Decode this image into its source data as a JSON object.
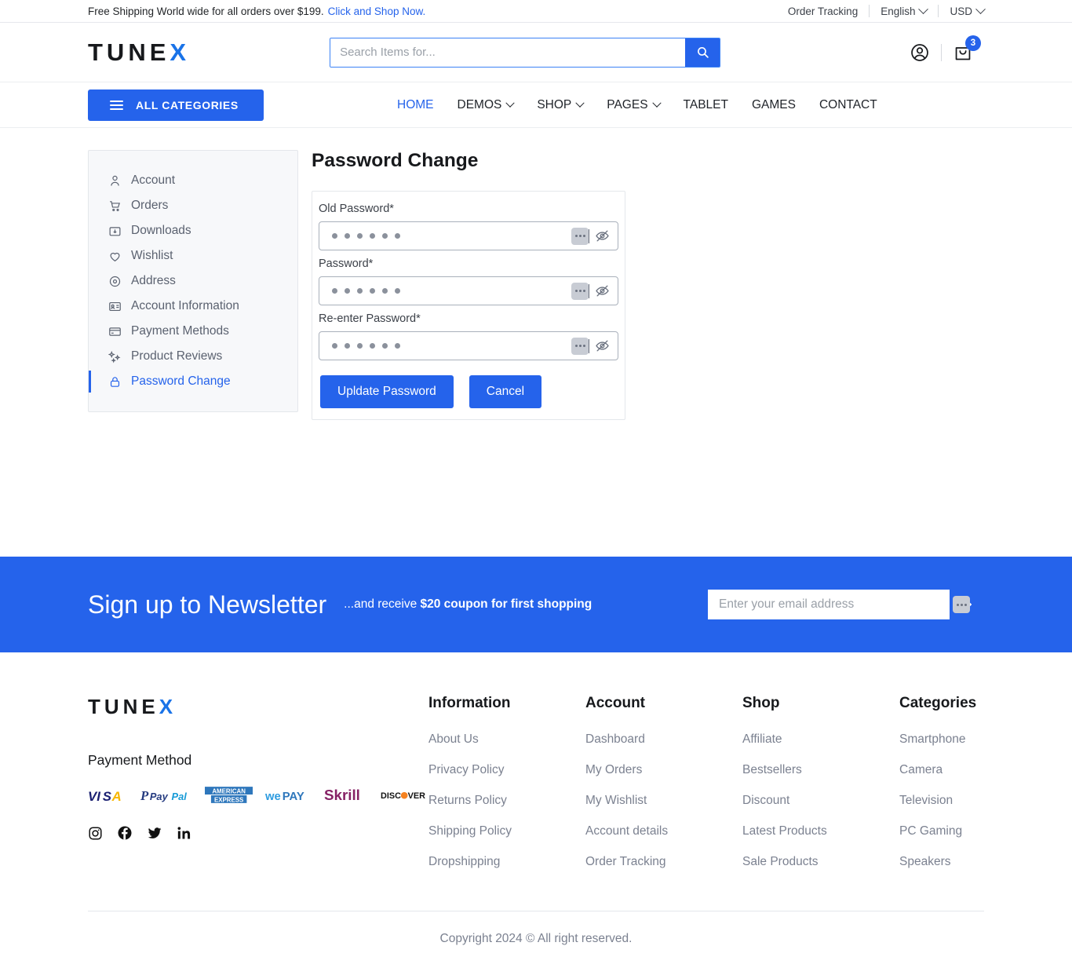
{
  "topbar": {
    "promo_text": "Free Shipping World wide for all orders over $199.",
    "promo_link": "Click and Shop Now.",
    "order_tracking": "Order Tracking",
    "language": "English",
    "currency": "USD"
  },
  "header": {
    "logo_main": "TUNE",
    "logo_accent": "X",
    "search_placeholder": "Search Items for...",
    "search_value": "",
    "cart_count": "3"
  },
  "nav": {
    "all_categories": "ALL CATEGORIES",
    "items": [
      {
        "label": "HOME",
        "active": true,
        "caret": false
      },
      {
        "label": "DEMOS",
        "active": false,
        "caret": true
      },
      {
        "label": "SHOP",
        "active": false,
        "caret": true
      },
      {
        "label": "PAGES",
        "active": false,
        "caret": true
      },
      {
        "label": "TABLET",
        "active": false,
        "caret": false
      },
      {
        "label": "GAMES",
        "active": false,
        "caret": false
      },
      {
        "label": "CONTACT",
        "active": false,
        "caret": false
      }
    ]
  },
  "sidebar": {
    "items": [
      {
        "label": "Account",
        "icon": "user-icon",
        "active": false
      },
      {
        "label": "Orders",
        "icon": "cart-icon",
        "active": false
      },
      {
        "label": "Downloads",
        "icon": "download-box-icon",
        "active": false
      },
      {
        "label": "Wishlist",
        "icon": "heart-icon",
        "active": false
      },
      {
        "label": "Address",
        "icon": "location-pin-icon",
        "active": false
      },
      {
        "label": "Account Information",
        "icon": "id-card-icon",
        "active": false
      },
      {
        "label": "Payment Methods",
        "icon": "credit-card-icon",
        "active": false
      },
      {
        "label": "Product Reviews",
        "icon": "sparkles-icon",
        "active": false
      },
      {
        "label": "Password Change",
        "icon": "lock-icon",
        "active": true
      }
    ]
  },
  "main": {
    "page_title": "Password Change",
    "fields": [
      {
        "label": "Old Password*",
        "value": "••••••",
        "dots": 6
      },
      {
        "label": "Password*",
        "value": "••••••",
        "dots": 6
      },
      {
        "label": "Re-enter Password*",
        "value": "••••••",
        "dots": 6
      }
    ],
    "update_button": "Upldate Password",
    "cancel_button": "Cancel"
  },
  "newsletter": {
    "title": "Sign up to Newsletter",
    "subtitle_prefix": "...and receive ",
    "subtitle_bold": "$20 coupon for first shopping",
    "email_placeholder": "Enter your email address",
    "email_value": ""
  },
  "footer": {
    "logo_main": "TUNE",
    "logo_accent": "X",
    "payment_title": "Payment Method",
    "payment_methods": [
      "VISA",
      "PayPal",
      "AMERICAN EXPRESS",
      "WEPAY",
      "Skrill",
      "DISCOVER"
    ],
    "social": [
      "instagram-icon",
      "facebook-icon",
      "twitter-icon",
      "linkedin-icon"
    ],
    "columns": [
      {
        "title": "Information",
        "links": [
          "About Us",
          "Privacy Policy",
          "Returns Policy",
          "Shipping Policy",
          "Dropshipping"
        ]
      },
      {
        "title": "Account",
        "links": [
          "Dashboard",
          "My Orders",
          "My Wishlist",
          "Account details",
          "Order Tracking"
        ]
      },
      {
        "title": "Shop",
        "links": [
          "Affiliate",
          "Bestsellers",
          "Discount",
          "Latest Products",
          "Sale Products"
        ]
      },
      {
        "title": "Categories",
        "links": [
          "Smartphone",
          "Camera",
          "Television",
          "PC Gaming",
          "Speakers"
        ]
      }
    ],
    "copyright": "Copyright 2024 © All right reserved."
  },
  "colors": {
    "brand_blue": "#2563eb",
    "logo_accent": "#1a73e8",
    "text_dark": "#17191c",
    "text_muted": "#7b8190"
  }
}
